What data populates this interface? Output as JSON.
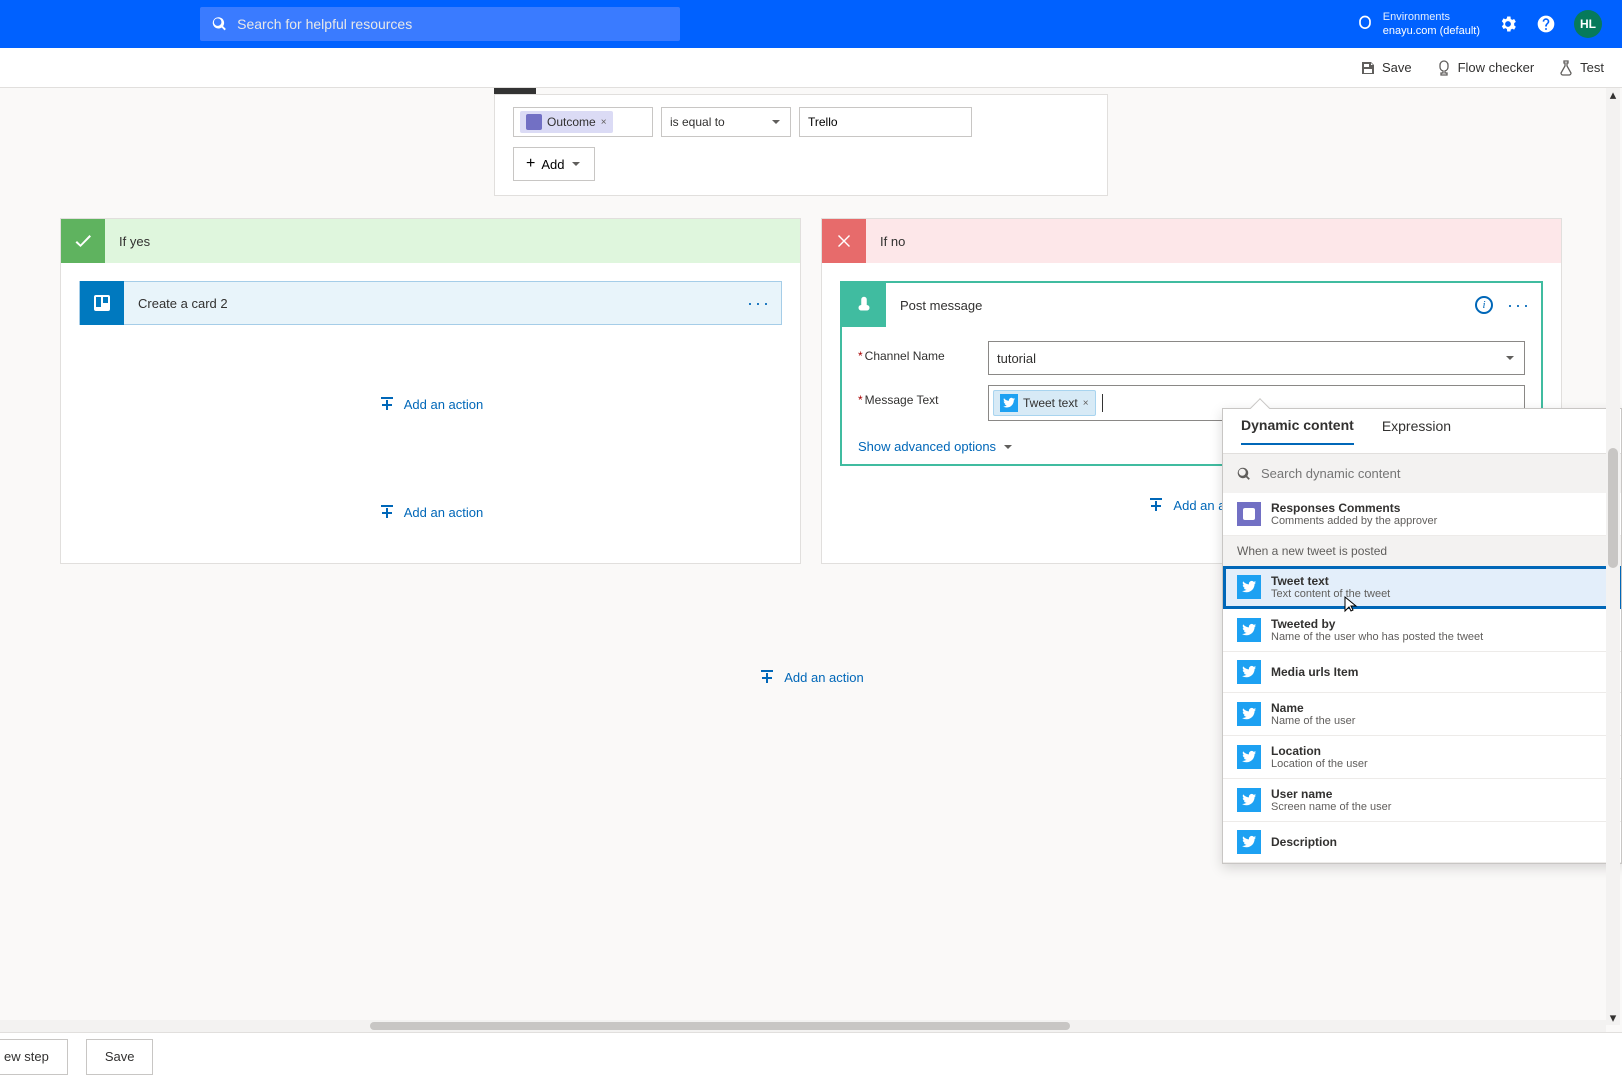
{
  "header": {
    "search_placeholder": "Search for helpful resources",
    "env_label": "Environments",
    "env_value": "enayu.com (default)",
    "avatar": "HL"
  },
  "commands": {
    "save": "Save",
    "flow_checker": "Flow checker",
    "test": "Test"
  },
  "condition": {
    "token_label": "Outcome",
    "operator": "is equal to",
    "value": "Trello",
    "add_btn": "Add"
  },
  "branches": {
    "yes_label": "If yes",
    "no_label": "If no",
    "trello_card_title": "Create a card 2",
    "slack_card_title": "Post message",
    "channel_label": "Channel Name",
    "channel_value": "tutorial",
    "message_label": "Message Text",
    "message_token": "Tweet text",
    "advanced": "Show advanced options",
    "add_action": "Add an action",
    "add_action_partial": "Add an act"
  },
  "dynamic": {
    "tab1": "Dynamic content",
    "tab2": "Expression",
    "search_placeholder": "Search dynamic content",
    "responses_title": "Responses Comments",
    "responses_desc": "Comments added by the approver",
    "section2": "When a new tweet is posted",
    "items": [
      {
        "title": "Tweet text",
        "desc": "Text content of the tweet"
      },
      {
        "title": "Tweeted by",
        "desc": "Name of the user who has posted the tweet"
      },
      {
        "title": "Media urls Item",
        "desc": ""
      },
      {
        "title": "Name",
        "desc": "Name of the user"
      },
      {
        "title": "Location",
        "desc": "Location of the user"
      },
      {
        "title": "User name",
        "desc": "Screen name of the user"
      },
      {
        "title": "Description",
        "desc": ""
      }
    ]
  },
  "bottom": {
    "new_step": "ew step",
    "save": "Save"
  }
}
